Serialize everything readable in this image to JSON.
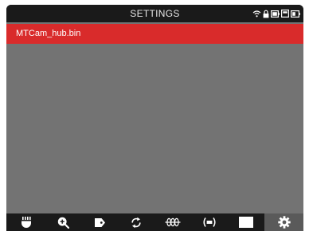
{
  "header": {
    "title": "SETTINGS",
    "status_icons": [
      "wifi-icon",
      "lock-icon",
      "battery-icon",
      "sd-card-icon",
      "battery-level-icon"
    ]
  },
  "list": {
    "items": [
      {
        "label": "MTCam_hub.bin",
        "selected": true
      }
    ]
  },
  "toolbar": {
    "items": [
      {
        "icon": "light-icon",
        "active": false
      },
      {
        "icon": "zoom-in-icon",
        "active": false
      },
      {
        "icon": "tag-icon",
        "active": false
      },
      {
        "icon": "rotate-icon",
        "active": false
      },
      {
        "icon": "cable-icon",
        "active": false
      },
      {
        "icon": "wireless-signal-icon",
        "active": false
      },
      {
        "icon": "blank-screen-icon",
        "active": false
      },
      {
        "icon": "settings-gear-icon",
        "active": true
      }
    ]
  },
  "colors": {
    "chrome": "#1a1a1a",
    "list_background": "#737373",
    "selection": "#d92b2b",
    "active_tool": "#5a5a5a",
    "text": "#ffffff"
  }
}
